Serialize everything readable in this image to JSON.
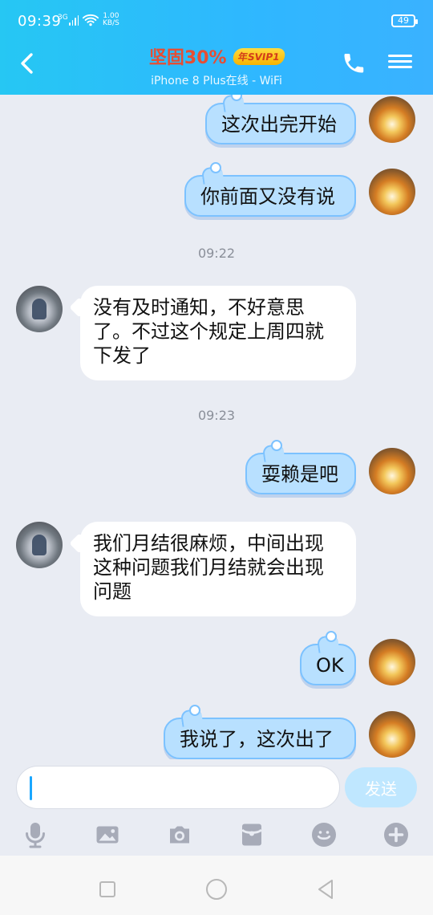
{
  "status": {
    "time": "09:39",
    "network": "3G",
    "speed_value": "1.00",
    "speed_unit": "KB/S",
    "battery": "49"
  },
  "header": {
    "title": "坚固30%",
    "vip_badge": "年SVIP1",
    "subtitle": "iPhone 8 Plus在线 - WiFi"
  },
  "messages": [
    {
      "side": "out",
      "text": "这次出完开始"
    },
    {
      "side": "out",
      "text": "你前面又没有说"
    },
    {
      "type": "timestamp",
      "text": "09:22"
    },
    {
      "side": "in",
      "lines": [
        "没有及时通知，不好意思",
        "了。不过这个规定上周四就",
        "下发了"
      ]
    },
    {
      "type": "timestamp",
      "text": "09:23"
    },
    {
      "side": "out",
      "text": "耍赖是吧"
    },
    {
      "side": "in",
      "lines": [
        "我们月结很麻烦，中间出现",
        "这种问题我们月结就会出现",
        "问题"
      ]
    },
    {
      "side": "out",
      "text": "OK"
    },
    {
      "side": "out",
      "text": "我说了，这次出了"
    }
  ],
  "input": {
    "value": "",
    "send_label": "发送"
  },
  "colors": {
    "header_gradient_start": "#26c7f3",
    "header_gradient_end": "#3ab2ff",
    "outgoing_bubble": "#b8e0ff",
    "incoming_bubble": "#ffffff",
    "send_button": "#bfe7ff"
  },
  "icons": {
    "tools": [
      "microphone-icon",
      "image-icon",
      "camera-icon",
      "red-envelope-icon",
      "emoji-icon",
      "plus-icon"
    ],
    "nav": [
      "recent-apps-icon",
      "home-icon",
      "back-icon"
    ]
  }
}
